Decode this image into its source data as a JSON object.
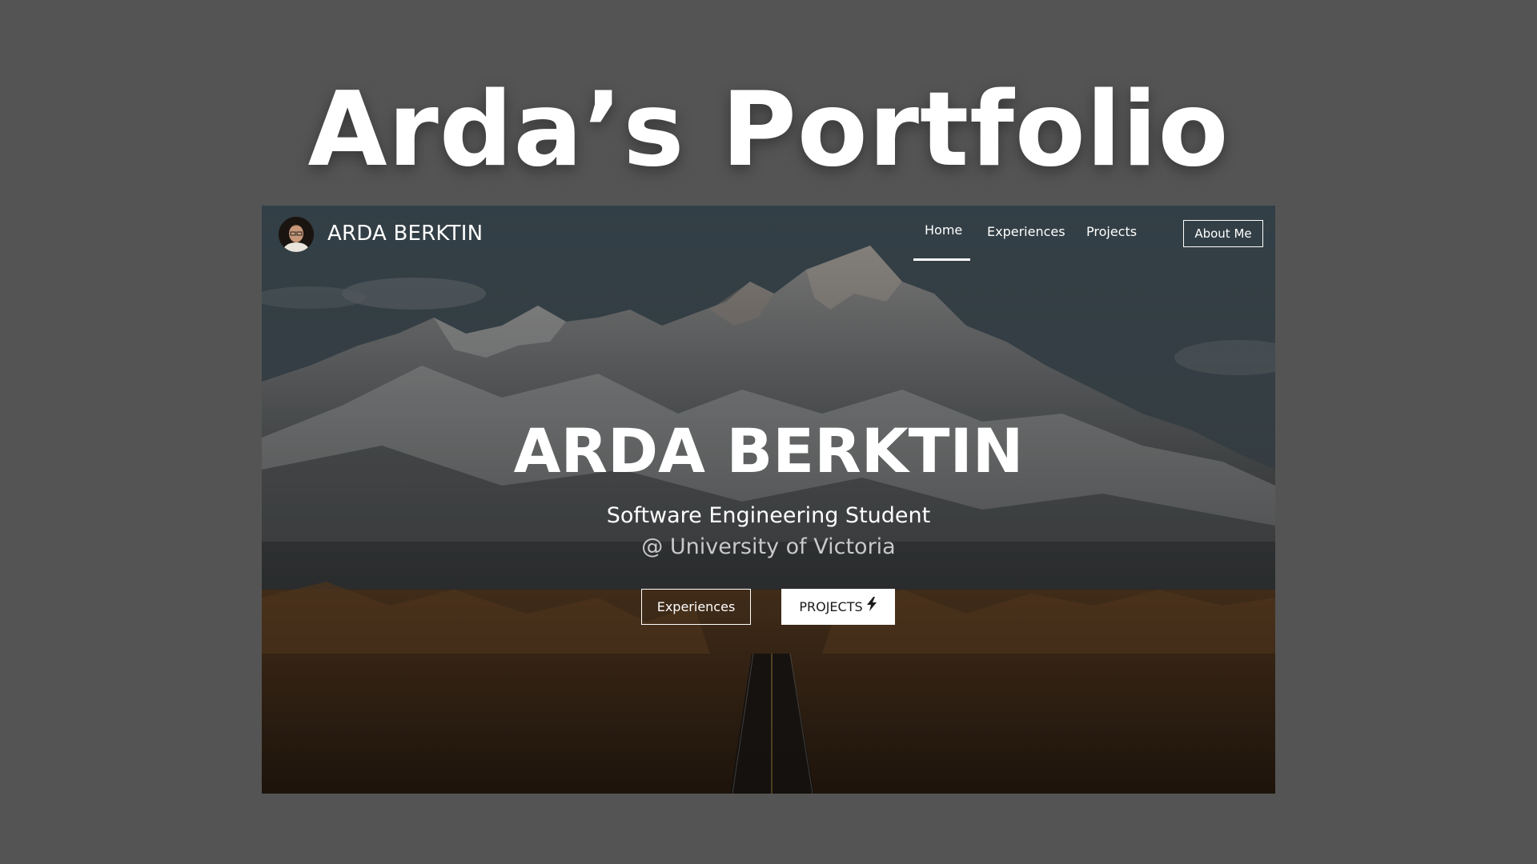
{
  "banner": {
    "title": "Arda’s Portfolio"
  },
  "nav": {
    "brand": "ARDA BERKTIN",
    "links": [
      {
        "label": "Home",
        "active": true
      },
      {
        "label": "Experiences"
      },
      {
        "label": "Projects"
      }
    ],
    "about_button": "About Me"
  },
  "hero": {
    "title": "ARDA BERKTIN",
    "subtitle": "Software Engineering Student",
    "school": "@ University of Victoria",
    "buttons": {
      "experiences": "Experiences",
      "projects": "PROJECTS",
      "projects_icon": "lightning-bolt-icon"
    }
  },
  "colors": {
    "page_background": "#545454",
    "text_primary": "#ffffff",
    "text_secondary": "#c9c9c9"
  }
}
